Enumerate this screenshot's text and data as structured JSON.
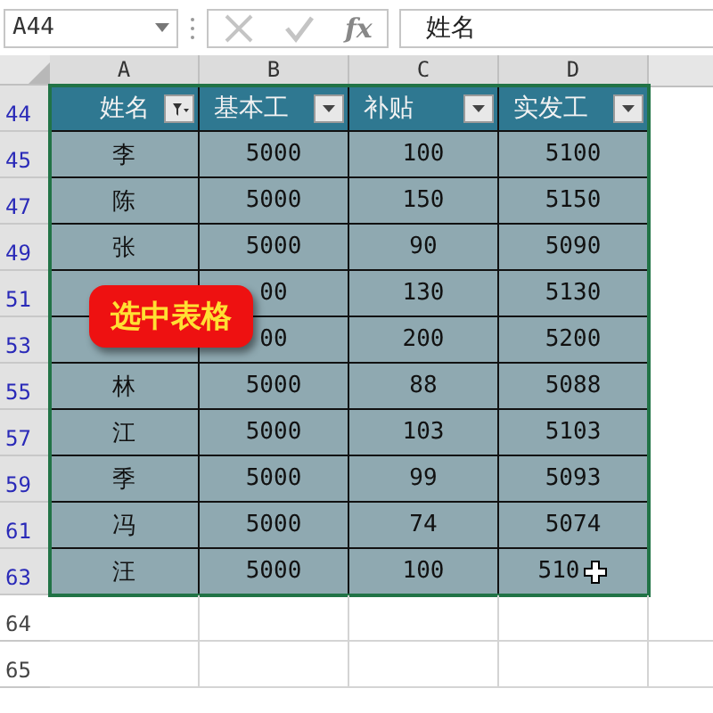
{
  "name_box": {
    "value": "A44"
  },
  "formula_bar": {
    "function_label": "fx",
    "value": "姓名"
  },
  "columns": [
    "A",
    "B",
    "C",
    "D"
  ],
  "table": {
    "header_row": {
      "row_number": "44",
      "filtered": true
    },
    "headers": [
      {
        "label": "姓名",
        "filter_active": true
      },
      {
        "label": "基本工",
        "filter_active": false
      },
      {
        "label": "补贴",
        "filter_active": false
      },
      {
        "label": "实发工",
        "filter_active": false
      }
    ],
    "rows": [
      {
        "row_number": "45",
        "filtered": true,
        "cells": [
          "李",
          "5000",
          "100",
          "5100"
        ]
      },
      {
        "row_number": "47",
        "filtered": true,
        "cells": [
          "陈",
          "5000",
          "150",
          "5150"
        ]
      },
      {
        "row_number": "49",
        "filtered": true,
        "cells": [
          "张",
          "5000",
          "90",
          "5090"
        ]
      },
      {
        "row_number": "51",
        "filtered": true,
        "cells": [
          "",
          "00",
          "130",
          "5130"
        ]
      },
      {
        "row_number": "53",
        "filtered": true,
        "cells": [
          "",
          "00",
          "200",
          "5200"
        ]
      },
      {
        "row_number": "55",
        "filtered": true,
        "cells": [
          "林",
          "5000",
          "88",
          "5088"
        ]
      },
      {
        "row_number": "57",
        "filtered": true,
        "cells": [
          "江",
          "5000",
          "103",
          "5103"
        ]
      },
      {
        "row_number": "59",
        "filtered": true,
        "cells": [
          "季",
          "5000",
          "99",
          "5093"
        ]
      },
      {
        "row_number": "61",
        "filtered": true,
        "cells": [
          "冯",
          "5000",
          "74",
          "5074"
        ]
      },
      {
        "row_number": "63",
        "filtered": true,
        "cells": [
          "汪",
          "5000",
          "100",
          "510"
        ]
      }
    ]
  },
  "blank_rows": [
    {
      "row_number": "64",
      "filtered": false
    },
    {
      "row_number": "65",
      "filtered": false
    }
  ],
  "callout": {
    "text": "选中表格"
  }
}
